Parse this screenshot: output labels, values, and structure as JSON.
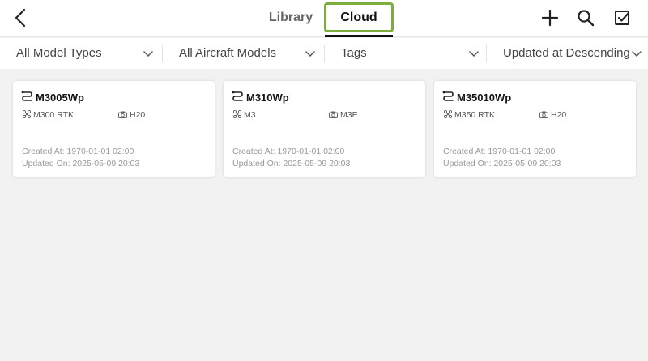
{
  "header": {
    "tabs": [
      {
        "label": "Library"
      },
      {
        "label": "Cloud"
      }
    ],
    "active_tab": "Cloud",
    "icons": [
      "back-arrow-icon",
      "plus-icon",
      "search-icon",
      "checkbox-icon"
    ]
  },
  "filters": [
    {
      "label": "All Model Types"
    },
    {
      "label": "All Aircraft Models"
    },
    {
      "label": "Tags"
    },
    {
      "label": "Updated at Descending"
    }
  ],
  "cards": [
    {
      "title": "M3005Wp",
      "aircraft": "M300 RTK",
      "camera": "H20",
      "created": "Created At: 1970-01-01 02:00",
      "updated": "Updated On: 2025-05-09 20:03"
    },
    {
      "title": "M310Wp",
      "aircraft": "M3",
      "camera": "M3E",
      "created": "Created At: 1970-01-01 02:00",
      "updated": "Updated On: 2025-05-09 20:03"
    },
    {
      "title": "M35010Wp",
      "aircraft": "M350 RTK",
      "camera": "H20",
      "created": "Created At: 1970-01-01 02:00",
      "updated": "Updated On: 2025-05-09 20:03"
    }
  ],
  "colors": {
    "accent_highlight": "#7cad3d",
    "background": "#f2f2f2",
    "card": "#ffffff"
  }
}
